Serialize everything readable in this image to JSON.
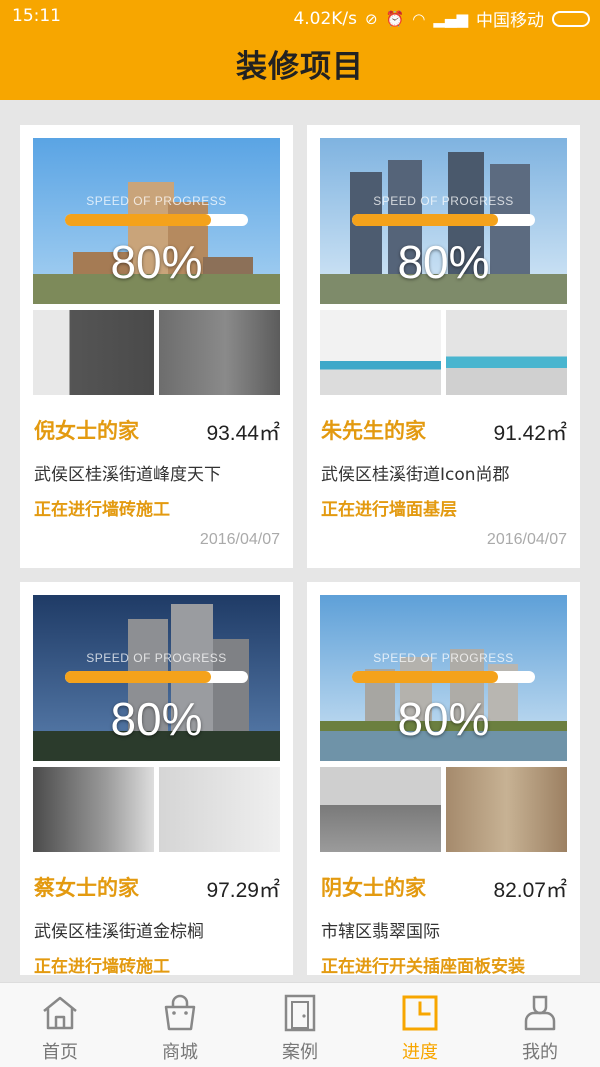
{
  "status_bar": {
    "time": "15:11",
    "speed": "4.02K/s",
    "carrier": "中国移动"
  },
  "header": {
    "title": "装修项目"
  },
  "projects": [
    {
      "progress_caption": "SPEED OF PROGRESS",
      "progress": 0.8,
      "progress_label": "80%",
      "name": "倪女士的家",
      "area": "93.44㎡",
      "address": "武侯区桂溪街道峰度天下",
      "status": "正在进行墙砖施工",
      "date": "2016/04/07"
    },
    {
      "progress_caption": "SPEED OF PROGRESS",
      "progress": 0.8,
      "progress_label": "80%",
      "name": "朱先生的家",
      "area": "91.42㎡",
      "address": "武侯区桂溪街道Icon尚郡",
      "status": "正在进行墙面基层",
      "date": "2016/04/07"
    },
    {
      "progress_caption": "SPEED OF PROGRESS",
      "progress": 0.8,
      "progress_label": "80%",
      "name": "蔡女士的家",
      "area": "97.29㎡",
      "address": "武侯区桂溪街道金棕榈",
      "status": "正在进行墙砖施工"
    },
    {
      "progress_caption": "SPEED OF PROGRESS",
      "progress": 0.8,
      "progress_label": "80%",
      "name": "阴女士的家",
      "area": "82.07㎡",
      "address": "市辖区翡翠国际",
      "status": "正在进行开关插座面板安装"
    }
  ],
  "tabs": [
    {
      "label": "首页",
      "icon": "home-icon",
      "active": false
    },
    {
      "label": "商城",
      "icon": "shopping-bag-icon",
      "active": false
    },
    {
      "label": "案例",
      "icon": "door-icon",
      "active": false
    },
    {
      "label": "进度",
      "icon": "clock-icon",
      "active": true
    },
    {
      "label": "我的",
      "icon": "person-icon",
      "active": false
    }
  ],
  "colors": {
    "accent": "#f7a600",
    "title": "#e39a10",
    "progress_fill": "#f4a21b"
  }
}
